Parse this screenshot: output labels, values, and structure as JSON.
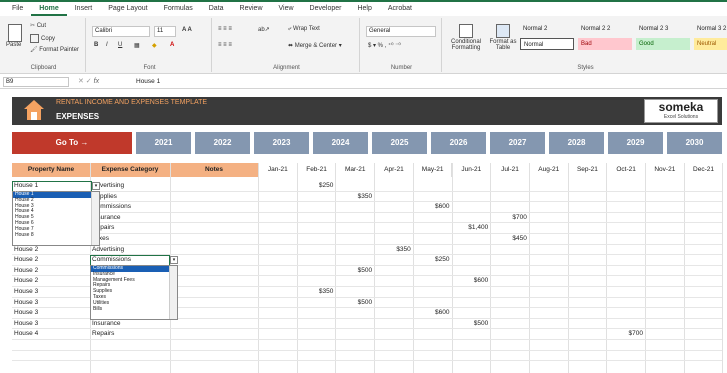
{
  "menu": [
    "File",
    "Home",
    "Insert",
    "Page Layout",
    "Formulas",
    "Data",
    "Review",
    "View",
    "Developer",
    "Help",
    "Acrobat"
  ],
  "ribbon": {
    "clipboard": {
      "paste": "Paste",
      "cut": "Cut",
      "copy": "Copy",
      "format_painter": "Format Painter",
      "title": "Clipboard"
    },
    "font": {
      "name": "Calibri",
      "size": "11",
      "title": "Font"
    },
    "alignment": {
      "wrap": "Wrap Text",
      "merge": "Merge & Center",
      "title": "Alignment"
    },
    "number": {
      "format": "General",
      "title": "Number"
    },
    "styles": {
      "cond": "Conditional Formatting",
      "table": "Format as Table",
      "title": "Styles",
      "cells": [
        "Normal 2",
        "Normal 2 2",
        "Normal 2 3",
        "Normal 3 2",
        "Normal",
        "Bad",
        "Good",
        "Neutral"
      ]
    }
  },
  "formula_bar": {
    "name_box": "B9",
    "fx": "fx",
    "content": "House 1"
  },
  "banner": {
    "subtitle": "RENTAL INCOME AND EXPENSES TEMPLATE",
    "title": "EXPENSES",
    "logo": "someka",
    "logo_sub": "Excel Solutions"
  },
  "goto": "Go To →",
  "years": [
    "2021",
    "2022",
    "2023",
    "2024",
    "2025",
    "2026",
    "2027",
    "2028",
    "2029",
    "2030"
  ],
  "headers": {
    "property": "Property Name",
    "category": "Expense Category",
    "notes": "Notes",
    "months": [
      "Jan-21",
      "Feb-21",
      "Mar-21",
      "Apr-21",
      "May-21",
      "Jun-21",
      "Jul-21",
      "Aug-21",
      "Sep-21",
      "Oct-21",
      "Nov-21",
      "Dec-21"
    ]
  },
  "rows": [
    {
      "property": "House 1",
      "category": "Advertising",
      "month": 1,
      "amount": "$250"
    },
    {
      "property": "House 1",
      "category": "Supplies",
      "month": 2,
      "amount": "$350"
    },
    {
      "property": "House 1",
      "category": "Commissions",
      "month": 4,
      "amount": "$600"
    },
    {
      "property": "House 1",
      "category": "Insurance",
      "month": 6,
      "amount": "$700"
    },
    {
      "property": "House 1",
      "category": "Repairs",
      "month": 5,
      "amount": "$1,400"
    },
    {
      "property": "House 1",
      "category": "Taxes",
      "month": 6,
      "amount": "$450"
    },
    {
      "property": "House 2",
      "category": "Advertising",
      "month": 3,
      "amount": "$350"
    },
    {
      "property": "House 2",
      "category": "Commissions",
      "month": 4,
      "amount": "$250"
    },
    {
      "property": "House 2",
      "category": "",
      "month": 2,
      "amount": "$500"
    },
    {
      "property": "House 2",
      "category": "",
      "month": 5,
      "amount": "$600"
    },
    {
      "property": "House 3",
      "category": "",
      "month": 1,
      "amount": "$350"
    },
    {
      "property": "House 3",
      "category": "",
      "month": 2,
      "amount": "$500"
    },
    {
      "property": "House 3",
      "category": "",
      "month": 4,
      "amount": "$600"
    },
    {
      "property": "House 3",
      "category": "Insurance",
      "month": 5,
      "amount": "$500"
    },
    {
      "property": "House 4",
      "category": "Repairs",
      "month": 9,
      "amount": "$700"
    }
  ],
  "dropdown_property": [
    "House 1",
    "House 2",
    "House 3",
    "House 4",
    "House 5",
    "House 6",
    "House 7",
    "House 8"
  ],
  "dropdown_category": [
    "Commissions",
    "Insurance",
    "Management Fees",
    "Repairs",
    "Supplies",
    "Taxes",
    "Utilities",
    "Bills"
  ],
  "colors": {
    "accent": "#217346",
    "orange": "#f4b183",
    "goto": "#c0392b",
    "year": "#8497b0",
    "banner": "#3a3a3a"
  }
}
